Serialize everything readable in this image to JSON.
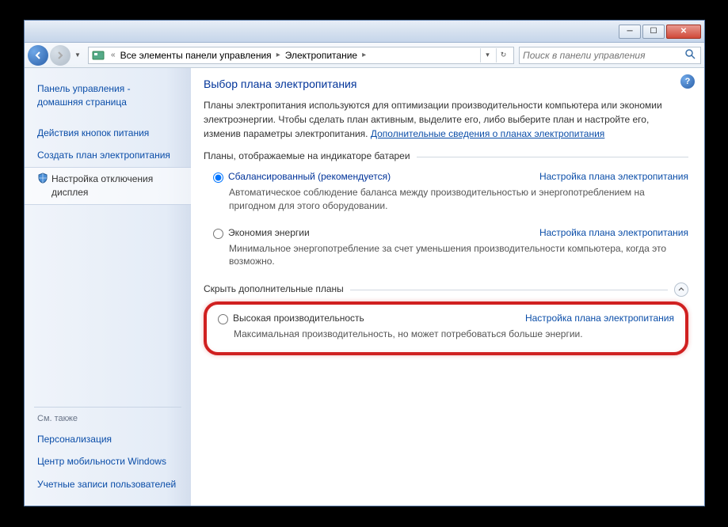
{
  "breadcrumb": {
    "item1": "Все элементы панели управления",
    "item2": "Электропитание"
  },
  "search": {
    "placeholder": "Поиск в панели управления"
  },
  "sidebar": {
    "home": "Панель управления - домашняя страница",
    "link1": "Действия кнопок питания",
    "link2": "Создать план электропитания",
    "link3": "Настройка отключения дисплея",
    "also_title": "См. также",
    "also1": "Персонализация",
    "also2": "Центр мобильности Windows",
    "also3": "Учетные записи пользователей"
  },
  "main": {
    "heading": "Выбор плана электропитания",
    "desc_pre": "Планы электропитания используются для оптимизации производительности компьютера или экономии электроэнергии. Чтобы сделать план активным, выделите его, либо выберите план и настройте его, изменив параметры электропитания. ",
    "desc_link": "Дополнительные сведения о планах электропитания",
    "group1_title": "Планы, отображаемые на индикаторе батареи",
    "group2_title": "Скрыть дополнительные планы",
    "plans": {
      "balanced": {
        "name": "Сбалансированный (рекомендуется)",
        "link": "Настройка плана электропитания",
        "desc": "Автоматическое соблюдение баланса между производительностью и энергопотреблением на пригодном для этого оборудовании."
      },
      "saver": {
        "name": "Экономия энергии",
        "link": "Настройка плана электропитания",
        "desc": "Минимальное энергопотребление за счет уменьшения производительности компьютера, когда это возможно."
      },
      "high": {
        "name": "Высокая производительность",
        "link": "Настройка плана электропитания",
        "desc": "Максимальная производительность, но может потребоваться больше энергии."
      }
    }
  }
}
